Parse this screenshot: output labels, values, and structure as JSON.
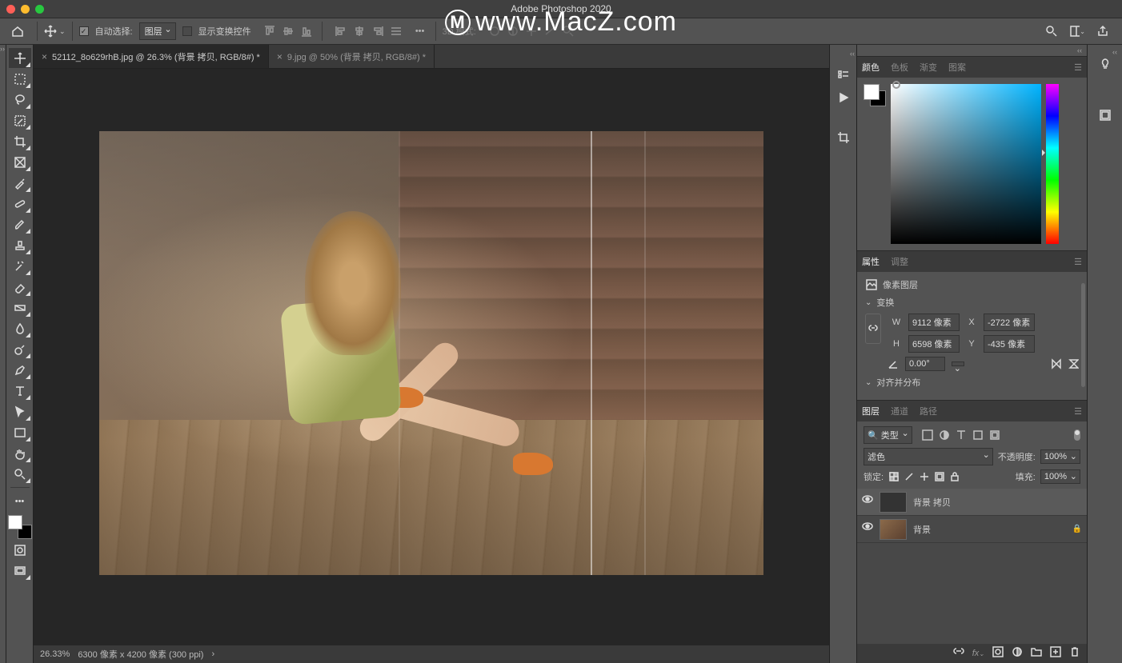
{
  "app_title": "Adobe Photoshop 2020",
  "watermark": "www.MacZ.com",
  "optionsbar": {
    "auto_select_label": "自动选择:",
    "auto_select_target": "图层",
    "show_transform_label": "显示变换控件",
    "mode_3d_label": "3D 模式:"
  },
  "tabs": [
    {
      "label": "52112_8o629rhB.jpg @ 26.3% (背景 拷贝, RGB/8#) *",
      "active": true
    },
    {
      "label": "9.jpg @ 50% (背景 拷贝, RGB/8#) *",
      "active": false
    }
  ],
  "statusbar": {
    "zoom": "26.33%",
    "info": "6300 像素 x 4200 像素 (300 ppi)"
  },
  "panels": {
    "color": {
      "tabs": [
        "颜色",
        "色板",
        "渐变",
        "图案"
      ]
    },
    "properties": {
      "tabs": [
        "属性",
        "调整"
      ],
      "kind": "像素图层",
      "transform_label": "变换",
      "W": "9112 像素",
      "H": "6598 像素",
      "X": "-2722 像素",
      "Y": "-435 像素",
      "angle": "0.00°",
      "align_label": "对齐并分布"
    },
    "layers": {
      "tabs": [
        "图层",
        "通道",
        "路径"
      ],
      "filter_kind": "类型",
      "blend_mode": "滤色",
      "opacity_label": "不透明度:",
      "opacity": "100%",
      "lock_label": "锁定:",
      "fill_label": "填充:",
      "fill": "100%",
      "items": [
        {
          "name": "背景 拷贝",
          "selected": true,
          "locked": false
        },
        {
          "name": "背景",
          "selected": false,
          "locked": true
        }
      ]
    }
  }
}
